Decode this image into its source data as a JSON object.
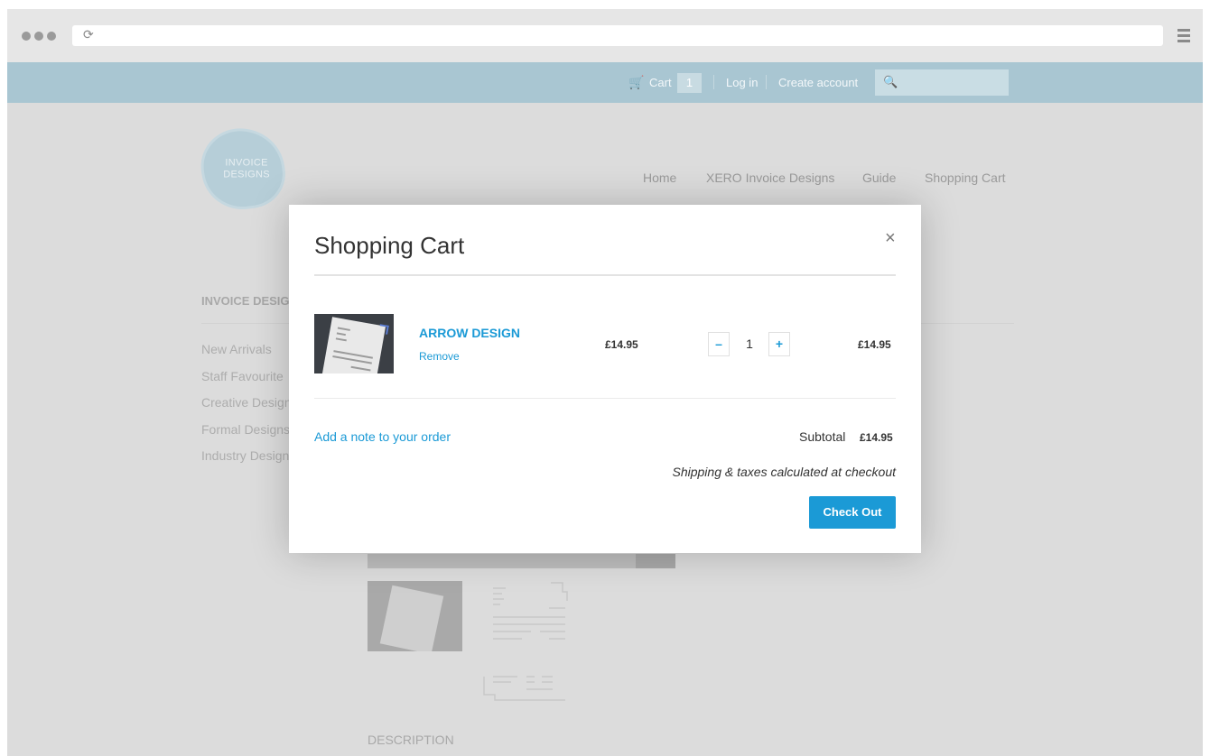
{
  "browser": {
    "reload_icon": "reload-icon",
    "menu_icon": "hamburger-menu-icon"
  },
  "topbar": {
    "cart_icon": "cart-icon",
    "cart_label": "Cart",
    "cart_count": "1",
    "login_label": "Log in",
    "create_account_label": "Create account",
    "search_icon": "search-icon",
    "search_placeholder": ""
  },
  "site": {
    "logo_text_line1": "INVOICE",
    "logo_text_line2": "DESIGNS",
    "nav": [
      {
        "label": "Home"
      },
      {
        "label": "XERO Invoice Designs"
      },
      {
        "label": "Guide"
      },
      {
        "label": "Shopping Cart"
      }
    ],
    "sidebar_heading": "INVOICE DESIG",
    "sidebar_items": [
      {
        "label": "New Arrivals"
      },
      {
        "label": "Staff Favourite"
      },
      {
        "label": "Creative Design"
      },
      {
        "label": "Formal Designs"
      },
      {
        "label": "Industry Design"
      }
    ],
    "description_heading": "DESCRIPTION"
  },
  "modal": {
    "title": "Shopping Cart",
    "close_symbol": "×",
    "item": {
      "name": "ARROW DESIGN",
      "remove_label": "Remove",
      "price": "£14.95",
      "quantity": "1",
      "minus_label": "–",
      "plus_label": "+",
      "line_total": "£14.95"
    },
    "note_link": "Add a note to your order",
    "subtotal_label": "Subtotal",
    "subtotal_value": "£14.95",
    "shipping_note": "Shipping & taxes calculated at checkout",
    "checkout_label": "Check Out"
  },
  "colors": {
    "accent": "#1b9ad6",
    "topbar": "#a9c6d2",
    "overlay_page": "#dcdcdc"
  }
}
